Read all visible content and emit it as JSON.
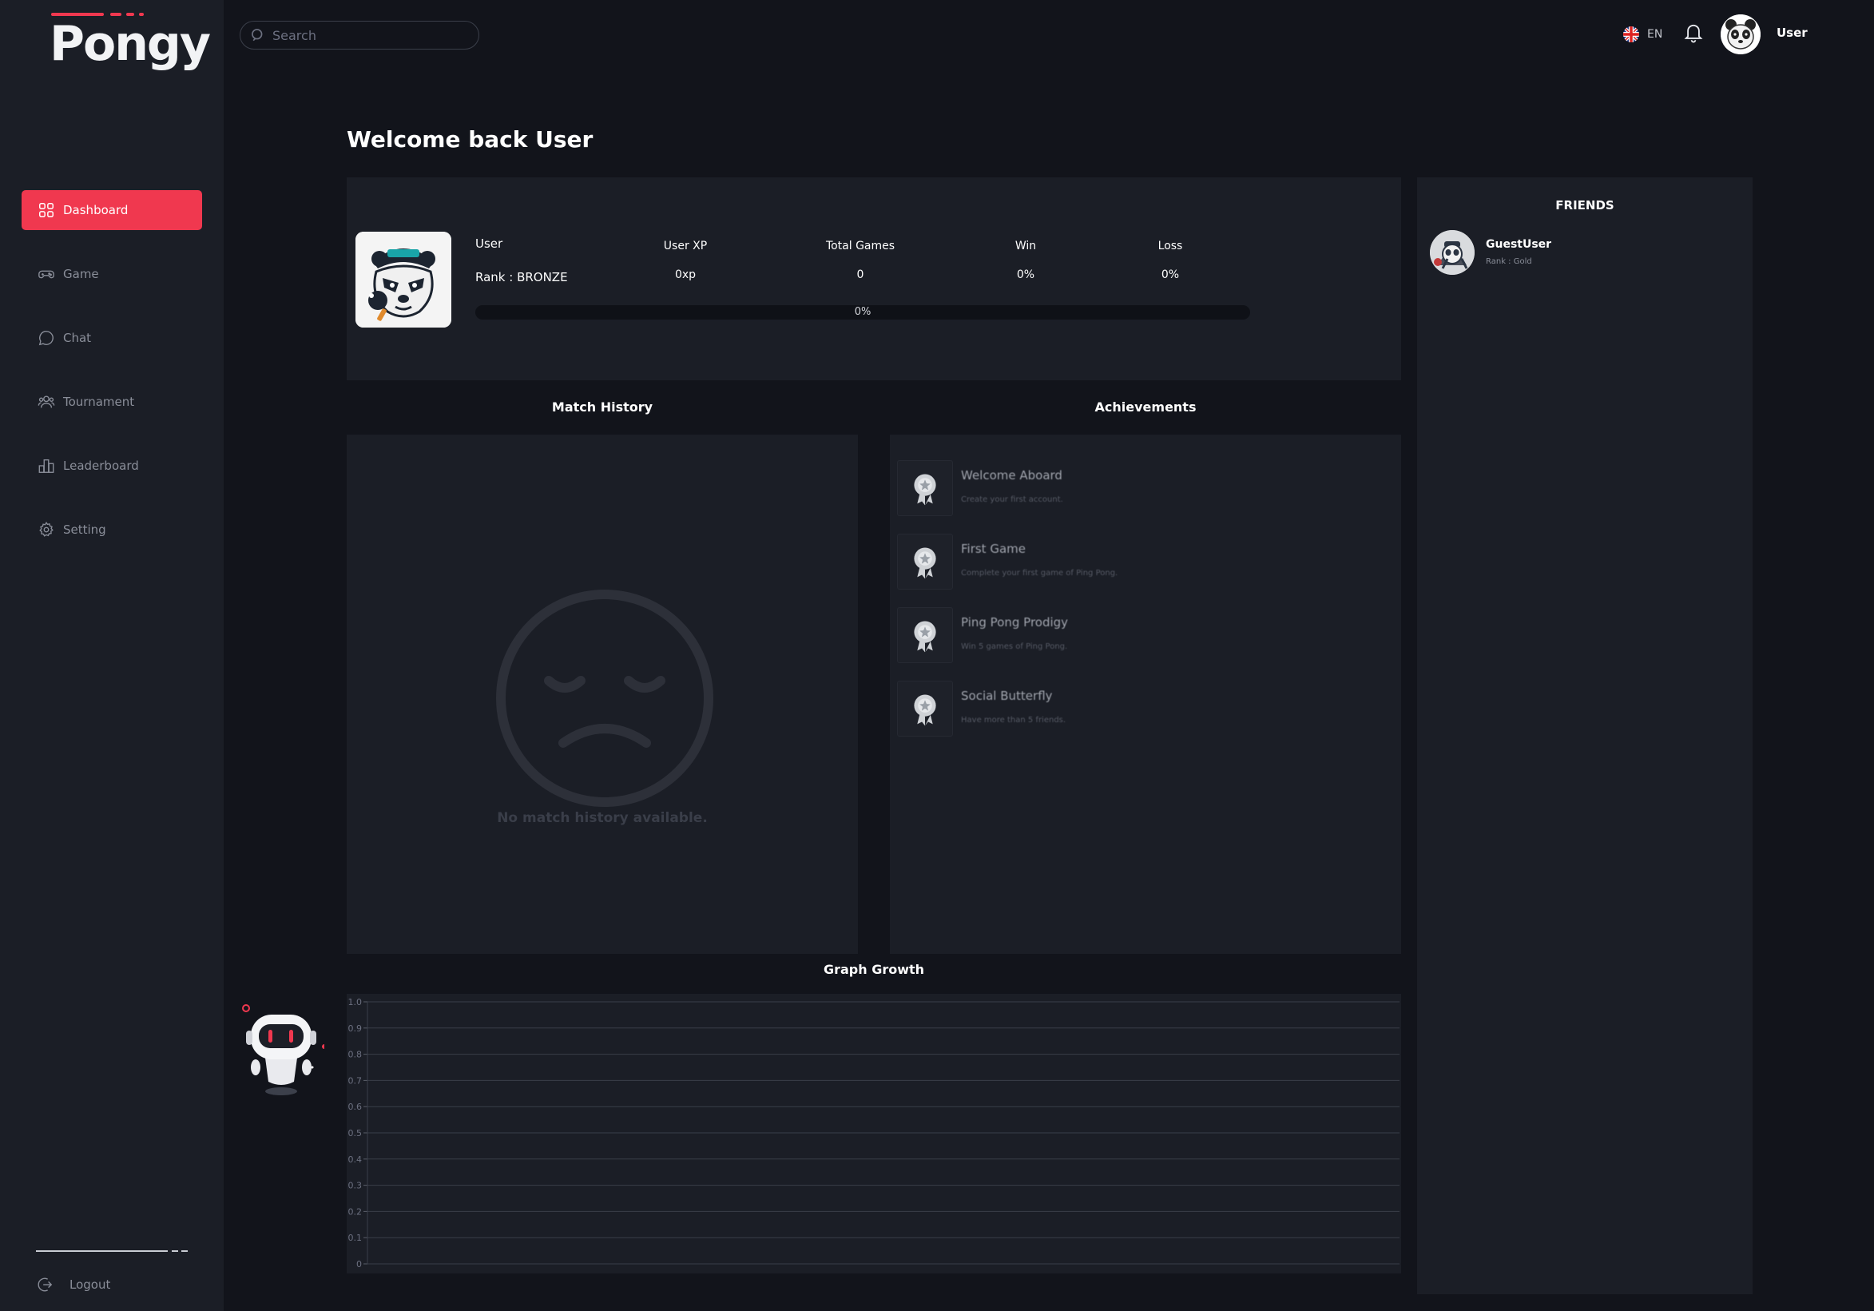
{
  "app": {
    "logo": "Pongy"
  },
  "sidebar": {
    "items": [
      {
        "label": "Dashboard",
        "icon": "dashboard-grid-icon",
        "active": true
      },
      {
        "label": "Game",
        "icon": "gamepad-icon",
        "active": false
      },
      {
        "label": "Chat",
        "icon": "chat-bubble-icon",
        "active": false
      },
      {
        "label": "Tournament",
        "icon": "users-icon",
        "active": false
      },
      {
        "label": "Leaderboard",
        "icon": "bar-chart-icon",
        "active": false
      },
      {
        "label": "Setting",
        "icon": "gear-icon",
        "active": false
      }
    ],
    "logout_label": "Logout"
  },
  "topbar": {
    "search_placeholder": "Search",
    "language": "EN",
    "username": "User"
  },
  "main": {
    "welcome": "Welcome back User",
    "profile": {
      "name": "User",
      "rank": "Rank : BRONZE",
      "stats": [
        {
          "label": "User XP",
          "value": "0xp"
        },
        {
          "label": "Total Games",
          "value": "0"
        },
        {
          "label": "Win",
          "value": "0%"
        },
        {
          "label": "Loss",
          "value": "0%"
        }
      ],
      "xp_progress_text": "0%",
      "xp_progress": 0
    },
    "match_history": {
      "title": "Match History",
      "empty_text": "No match history available."
    },
    "achievements": {
      "title": "Achievements",
      "items": [
        {
          "title": "Welcome Aboard",
          "desc": "Create your first account."
        },
        {
          "title": "First Game",
          "desc": "Complete your first game of Ping Pong."
        },
        {
          "title": "Ping Pong Prodigy",
          "desc": "Win 5 games of Ping Pong."
        },
        {
          "title": "Social Butterfly",
          "desc": "Have more than 5 friends."
        }
      ]
    },
    "graph": {
      "title": "Graph Growth"
    }
  },
  "chart_data": {
    "type": "line",
    "title": "Graph Growth",
    "x": [],
    "series": [],
    "ylim": [
      0,
      1
    ],
    "yticks": [
      "0",
      "0.1",
      "0.2",
      "0.3",
      "0.4",
      "0.5",
      "0.6",
      "0.7",
      "0.8",
      "0.9",
      "1.0"
    ],
    "grid": true
  },
  "friends": {
    "title": "FRIENDS",
    "items": [
      {
        "name": "GuestUser",
        "rank": "Rank : Gold"
      }
    ]
  },
  "colors": {
    "accent": "#f0384f",
    "background": "#12141b",
    "panel": "#1b1e26"
  }
}
